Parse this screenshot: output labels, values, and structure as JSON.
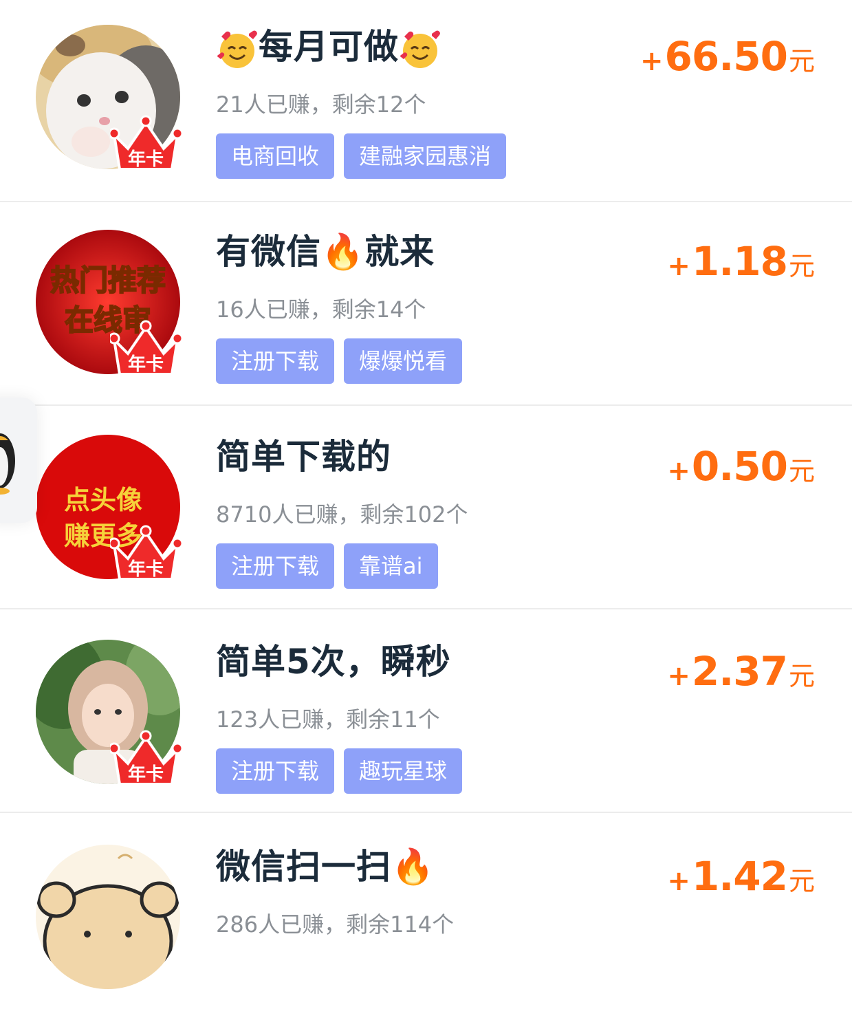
{
  "items": [
    {
      "title": "每月可做",
      "title_prefix_icon": "smiling-face-with-hearts-icon",
      "title_suffix_icon": "smiling-face-with-hearts-icon",
      "stats": "21人已赚，剩余12个",
      "tags": [
        "电商回收",
        "建融家园惠消"
      ],
      "price_plus": "+",
      "price_amount": "66.50",
      "price_unit": "元",
      "badge": "年卡"
    },
    {
      "title": "有微信🔥就来",
      "stats": "16人已赚，剩余14个",
      "tags": [
        "注册下载",
        "爆爆悦看"
      ],
      "price_plus": "+",
      "price_amount": "1.18",
      "price_unit": "元",
      "badge": "年卡",
      "avatar_text": [
        "热门推荐",
        "在线审"
      ]
    },
    {
      "title": "简单下载的",
      "stats": "8710人已赚，剩余102个",
      "tags": [
        "注册下载",
        "靠谱ai"
      ],
      "price_plus": "+",
      "price_amount": "0.50",
      "price_unit": "元",
      "badge": "年卡",
      "avatar_text": [
        "点头像",
        "赚更多"
      ]
    },
    {
      "title": "简单5次，瞬秒",
      "stats": "123人已赚，剩余11个",
      "tags": [
        "注册下载",
        "趣玩星球"
      ],
      "price_plus": "+",
      "price_amount": "2.37",
      "price_unit": "元",
      "badge": "年卡"
    },
    {
      "title": "微信扫一扫🔥",
      "stats": "286人已赚，剩余114个",
      "tags": [],
      "price_plus": "+",
      "price_amount": "1.42",
      "price_unit": "元"
    }
  ],
  "colors": {
    "price": "#ff6d10",
    "tag_bg": "#8ea1f9",
    "title": "#1b2b3a",
    "stats": "#8a8f95"
  }
}
